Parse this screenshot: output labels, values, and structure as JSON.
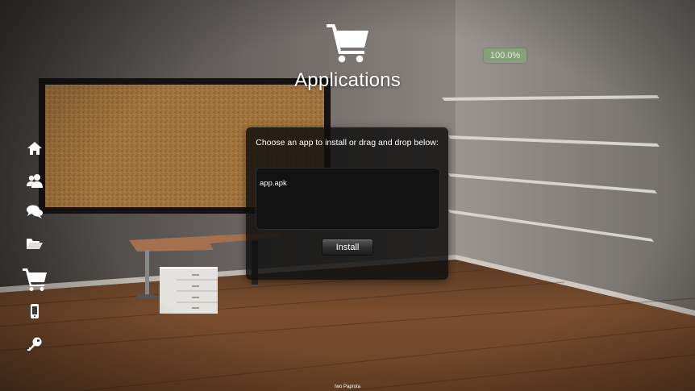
{
  "header": {
    "title": "Applications",
    "icon": "shopping-cart-icon"
  },
  "progress": {
    "label": "100.0%",
    "value": 100.0
  },
  "sidebar": {
    "items": [
      {
        "name": "home",
        "icon": "home-icon"
      },
      {
        "name": "contacts",
        "icon": "users-icon"
      },
      {
        "name": "messages",
        "icon": "chat-bubbles-icon"
      },
      {
        "name": "files",
        "icon": "folder-open-icon"
      },
      {
        "name": "applications",
        "icon": "shopping-cart-icon",
        "active": true
      },
      {
        "name": "device",
        "icon": "phone-icon"
      },
      {
        "name": "settings",
        "icon": "key-icon"
      }
    ]
  },
  "dialog": {
    "prompt": "Choose an app to install or drag and drop below:",
    "file_name": "app.apk",
    "install_label": "Install"
  },
  "footer": {
    "credit": "Iwo Paprota"
  },
  "colors": {
    "icon": "#ffffff",
    "progress": "#8fa882",
    "dialog_bg": "#0e0e0e"
  }
}
